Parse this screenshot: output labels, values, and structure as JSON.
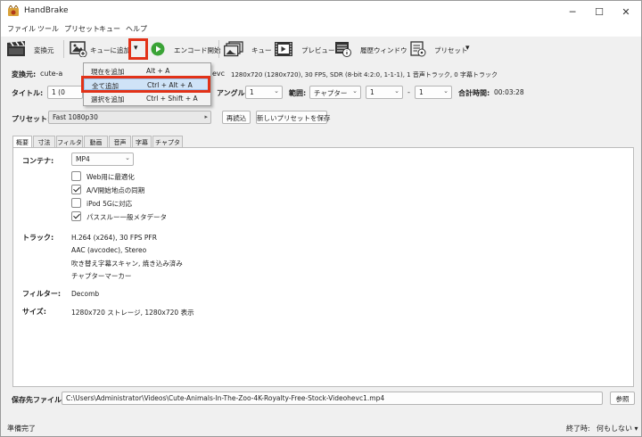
{
  "app": {
    "title": "HandBrake",
    "logo": "handbrake-logo"
  },
  "window_controls": {
    "minimize": "─",
    "maximize": "☐",
    "close": "✕"
  },
  "menu": [
    "ファイル",
    "ツール",
    "プリセット",
    "キュー",
    "ヘルプ"
  ],
  "toolbar": {
    "source": "変換元",
    "add_queue": "キューに追加",
    "start": "エンコード開始",
    "queue": "キュー",
    "preview": "プレビュー",
    "activity": "履歴ウィンドウ",
    "presets": "プリセット",
    "dropdown_arrow": "▾"
  },
  "queue_dropdown": {
    "items": [
      {
        "label": "現在を追加",
        "shortcut": "Alt + A"
      },
      {
        "label": "全て追加",
        "shortcut": "Ctrl + Alt + A",
        "highlighted": true
      },
      {
        "label": "選択を追加",
        "shortcut": "Ctrl + Shift + A"
      }
    ]
  },
  "source": {
    "label": "変換元:",
    "name_prefix": "cute-a",
    "name_suffix": "evc",
    "info": "1280x720 (1280x720), 30 FPS, SDR (8-bit 4:2:0, 1-1-1), 1 音声トラック, 0 字幕トラック"
  },
  "title_row": {
    "label": "タイトル:",
    "title_value": "1 (0",
    "angle_label": "アングル:",
    "angle_value": "1",
    "range_label": "範囲:",
    "range_type": "チャプター",
    "range_start": "1",
    "range_dash": "-",
    "range_end": "1",
    "duration_label": "合計時間:",
    "duration_value": "00:03:28"
  },
  "preset_row": {
    "label": "プリセット:",
    "value": "Fast 1080p30",
    "reload": "再読込",
    "save_new": "新しいプリセットを保存",
    "arrow": "▸"
  },
  "tabs": [
    "概要",
    "寸法",
    "フィルタ",
    "動画",
    "音声",
    "字幕",
    "チャプター"
  ],
  "summary": {
    "container_label": "コンテナ:",
    "container_value": "MP4",
    "options": [
      {
        "label": "Web用に最適化",
        "checked": false
      },
      {
        "label": "A/V開始地点の同期",
        "checked": true
      },
      {
        "label": "iPod 5Gに対応",
        "checked": false
      },
      {
        "label": "パススルー一般メタデータ",
        "checked": true
      }
    ],
    "tracks_label": "トラック:",
    "tracks": [
      "H.264 (x264), 30 FPS PFR",
      "AAC (avcodec), Stereo",
      "吹き替え字幕スキャン, 焼き込み済み",
      "チャプターマーカー"
    ],
    "filters_label": "フィルター:",
    "filters_value": "Decomb",
    "size_label": "サイズ:",
    "size_value": "1280x720 ストレージ, 1280x720 表示"
  },
  "destination": {
    "label": "保存先ファイル:",
    "path": "C:\\Users\\Administrator\\Videos\\Cute-Animals-In-The-Zoo-4K-Royalty-Free-Stock-Videohevc1.mp4",
    "browse": "参照"
  },
  "status": {
    "text": "準備完了",
    "when_done_label": "終了時:",
    "when_done_value": "何もしない ▾"
  },
  "colors": {
    "highlight_box": "#e23218",
    "start_green": "#3aa336"
  }
}
